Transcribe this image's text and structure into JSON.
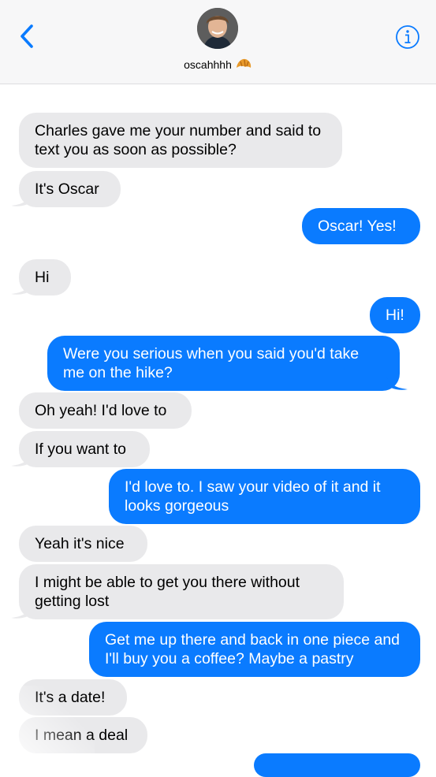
{
  "header": {
    "contact_name": "oscahhhh",
    "contact_emoji": "croissant-emoji",
    "back_icon": "chevron-left-icon",
    "info_icon": "info-circle-icon"
  },
  "colors": {
    "sent_bubble": "#0a7bff",
    "received_bubble": "#e9e9eb",
    "accent": "#0a7bff"
  },
  "messages": [
    {
      "from": "them",
      "text": "Charles gave me your number and said to text you as soon as possible?"
    },
    {
      "from": "them",
      "text": "It's Oscar"
    },
    {
      "from": "me",
      "text": "Oscar! Yes!"
    },
    {
      "from": "them",
      "text": "Hi"
    },
    {
      "from": "me",
      "text": "Hi!"
    },
    {
      "from": "me",
      "text": "Were you serious when you said you'd take me on the hike?"
    },
    {
      "from": "them",
      "text": "Oh yeah! I'd love to"
    },
    {
      "from": "them",
      "text": "If you want to"
    },
    {
      "from": "me",
      "text": "I'd love to. I saw your video of it and it looks gorgeous"
    },
    {
      "from": "them",
      "text": "Yeah it's nice"
    },
    {
      "from": "them",
      "text": "I might be able to get you there without getting lost"
    },
    {
      "from": "me",
      "text": "Get me up there and back in one piece and I'll buy you a coffee? Maybe a pastry"
    },
    {
      "from": "them",
      "text": "It's a date!"
    },
    {
      "from": "them",
      "text": "I mean a deal"
    }
  ]
}
